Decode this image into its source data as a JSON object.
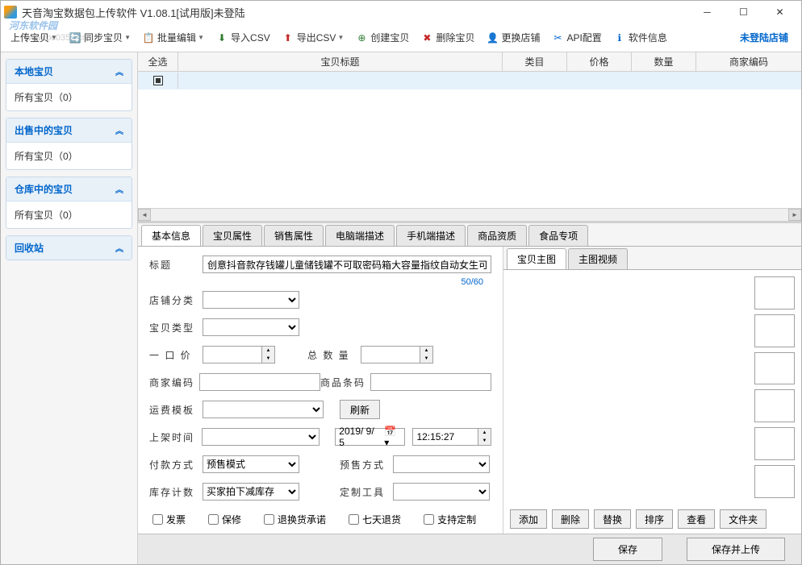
{
  "window": {
    "title": "天音淘宝数据包上传软件 V1.08.1[试用版]未登陆"
  },
  "watermark": {
    "text": "河东软件园",
    "sub": "www.pc0359.cn"
  },
  "toolbar": {
    "upload": "上传宝贝",
    "sync": "同步宝贝",
    "batch_edit": "批量编辑",
    "import_csv": "导入CSV",
    "export_csv": "导出CSV",
    "create": "创建宝贝",
    "delete": "删除宝贝",
    "switch_shop": "更换店铺",
    "api_config": "API配置",
    "software_info": "软件信息",
    "not_logged": "未登陆店铺"
  },
  "sidebar": {
    "panels": [
      {
        "title": "本地宝贝",
        "body": "所有宝贝（0）"
      },
      {
        "title": "出售中的宝贝",
        "body": "所有宝贝（0）"
      },
      {
        "title": "仓库中的宝贝",
        "body": "所有宝贝（0）"
      },
      {
        "title": "回收站",
        "body": null
      }
    ]
  },
  "grid": {
    "columns": {
      "check": "全选",
      "title": "宝贝标题",
      "category": "类目",
      "price": "价格",
      "quantity": "数量",
      "code": "商家编码"
    }
  },
  "tabs": {
    "basic": "基本信息",
    "attrs": "宝贝属性",
    "sales_attrs": "销售属性",
    "pc_desc": "电脑端描述",
    "mobile_desc": "手机端描述",
    "qualification": "商品资质",
    "food": "食品专项"
  },
  "form": {
    "title_label": "标题",
    "title_value": "创意抖音款存钱罐儿童储钱罐不可取密码箱大容量指纹自动女生可爱",
    "title_counter": "50/60",
    "shop_category": "店铺分类",
    "item_type": "宝贝类型",
    "price": "一 口 价",
    "total_qty": "总 数 量",
    "merchant_code": "商家编码",
    "barcode": "商品条码",
    "shipping_template": "运费模板",
    "refresh": "刷新",
    "list_time": "上架时间",
    "date_value": "2019/ 9/ 5",
    "time_value": "12:15:27",
    "payment_method": "付款方式",
    "payment_value": "预售模式",
    "presale_method": "预售方式",
    "stock_count": "库存计数",
    "stock_value": "买家拍下减库存",
    "custom_tool": "定制工具",
    "invoice": "发票",
    "warranty": "保修",
    "return_promise": "退换货承诺",
    "seven_day": "七天退货",
    "support_custom": "支持定制"
  },
  "image_panel": {
    "tab_main": "宝贝主图",
    "tab_video": "主图视频",
    "add": "添加",
    "delete": "删除",
    "replace": "替换",
    "sort": "排序",
    "view": "查看",
    "folder": "文件夹"
  },
  "bottom": {
    "save": "保存",
    "save_upload": "保存并上传"
  }
}
